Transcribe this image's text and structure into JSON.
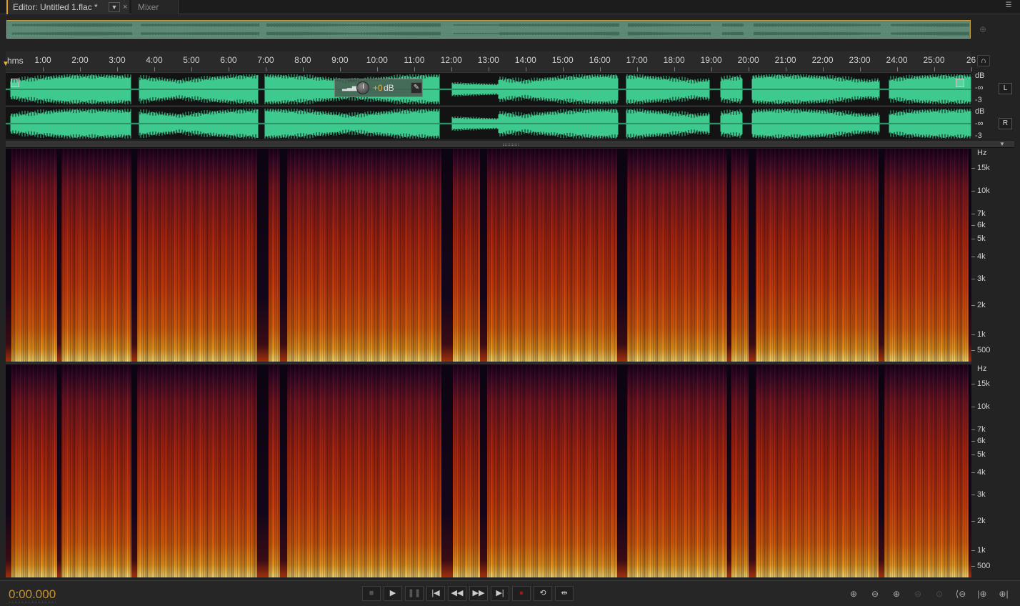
{
  "tabs": {
    "editor_label": "Editor: Untitled 1.flac *",
    "editor_dropdown_icon": "chevron-down-icon",
    "editor_close": "×",
    "mixer_label": "Mixer",
    "panel_menu_icon": "panel-menu-icon"
  },
  "ruler": {
    "units": "hms",
    "ticks": [
      "1:00",
      "2:00",
      "3:00",
      "4:00",
      "5:00",
      "6:00",
      "7:00",
      "8:00",
      "9:00",
      "10:00",
      "11:00",
      "12:00",
      "13:00",
      "14:00",
      "15:00",
      "16:00",
      "17:00",
      "18:00",
      "19:00",
      "20:00",
      "21:00",
      "22:00",
      "23:00",
      "24:00",
      "25:00",
      "26"
    ]
  },
  "waveform": {
    "color": "#3ec98f",
    "channels": [
      {
        "label": "L",
        "scale": [
          "dB",
          "-∞",
          "-3"
        ]
      },
      {
        "label": "R",
        "scale": [
          "dB",
          "-∞",
          "-3"
        ]
      }
    ]
  },
  "hud": {
    "volume_value": "+0",
    "volume_unit": "dB",
    "pin_icon": "pin-icon",
    "meter_icon": "level-meter-icon",
    "knob_icon": "volume-knob-icon"
  },
  "spectral": {
    "unit": "Hz",
    "freq_labels": [
      "15k",
      "10k",
      "7k",
      "6k",
      "5k",
      "4k",
      "3k",
      "2k",
      "1k",
      "500"
    ]
  },
  "transport": {
    "timecode": "0:00.000",
    "buttons": [
      "stop-icon",
      "play-icon",
      "pause-icon",
      "skip-to-start-icon",
      "rewind-icon",
      "fast-forward-icon",
      "skip-to-end-icon",
      "record-icon",
      "loop-icon",
      "skip-selection-icon"
    ]
  },
  "zoom_buttons": [
    "zoom-in-amplitude-icon",
    "zoom-out-amplitude-icon",
    "zoom-in-time-icon",
    "zoom-out-time-icon",
    "zoom-selection-icon",
    "zoom-out-full-icon",
    "zoom-in-left-icon",
    "zoom-in-right-icon"
  ],
  "colors": {
    "accent": "#e3b23c",
    "waveform": "#3ec98f",
    "timecode": "#c9922c"
  }
}
